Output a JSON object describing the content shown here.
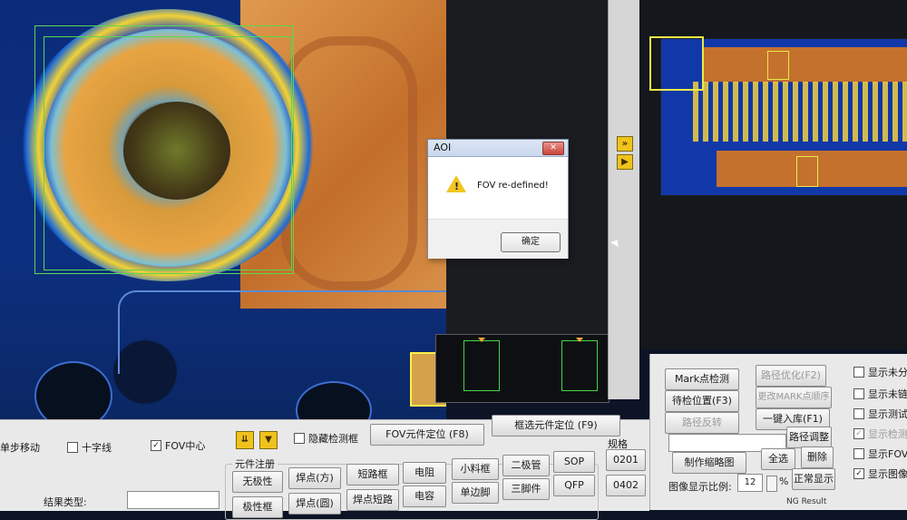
{
  "dialog": {
    "title": "AOI",
    "close_glyph": "✕",
    "message": "FOV re-defined!",
    "ok_label": "确定",
    "icon": "warning-icon"
  },
  "toolbar": {
    "step_move": "单步移动",
    "crosshair": "十字线",
    "fov_center": "FOV中心",
    "hide_detect_box": "隐藏检测框",
    "fov_locate": "FOV元件定位 (F8)",
    "filter_locate": "框选元件定位 (F9)",
    "arrow_down_double": "⇊",
    "arrow_down": "▼",
    "checked_glyph": "✓"
  },
  "element_register": {
    "group_label": "元件注册",
    "buttons": [
      "无极性",
      "焊点(方)",
      "短路框",
      "电阻",
      "小料框",
      "二极管",
      "SOP",
      "极性框",
      "焊点(圆)",
      "焊点短路",
      "电容",
      "单边脚",
      "三脚件",
      "QFP"
    ]
  },
  "spec": {
    "group_label": "规格",
    "buttons": [
      "0201",
      "0402"
    ]
  },
  "result_type_label": "结果类型:",
  "right_panel": {
    "buttons": {
      "mark_detect": "Mark点检测",
      "path_optimize": "路径优化(F2)",
      "wait_position": "待检位置(F3)",
      "change_mark_order": "更改MARK点顺序",
      "path_reverse": "路径反转",
      "one_key_import": "一键入库(F1)",
      "path_adjust": "路径调整",
      "make_thumbnail": "制作缩略图",
      "select_all": "全选",
      "delete": "删除",
      "normal_display": "正常显示"
    },
    "zoom_label": "图像显示比例:",
    "zoom_value": "12",
    "zoom_unit": "%",
    "checkboxes": [
      {
        "label": "显示未分配框",
        "checked": false
      },
      {
        "label": "显示未链接",
        "checked": false
      },
      {
        "label": "显示测试框",
        "checked": false
      },
      {
        "label": "显示检测区",
        "checked": true
      },
      {
        "label": "显示FOV框",
        "checked": false
      },
      {
        "label": "显示图像",
        "checked": true
      }
    ],
    "status_text": "NG Result"
  },
  "side_buttons": {
    "double_right": "»",
    "right": "▶"
  },
  "colors": {
    "fov_green": "#58d84f",
    "warning_yellow": "#f3c623",
    "arrow_yellow": "#f0c21c",
    "board_blue": "#1138a8"
  }
}
